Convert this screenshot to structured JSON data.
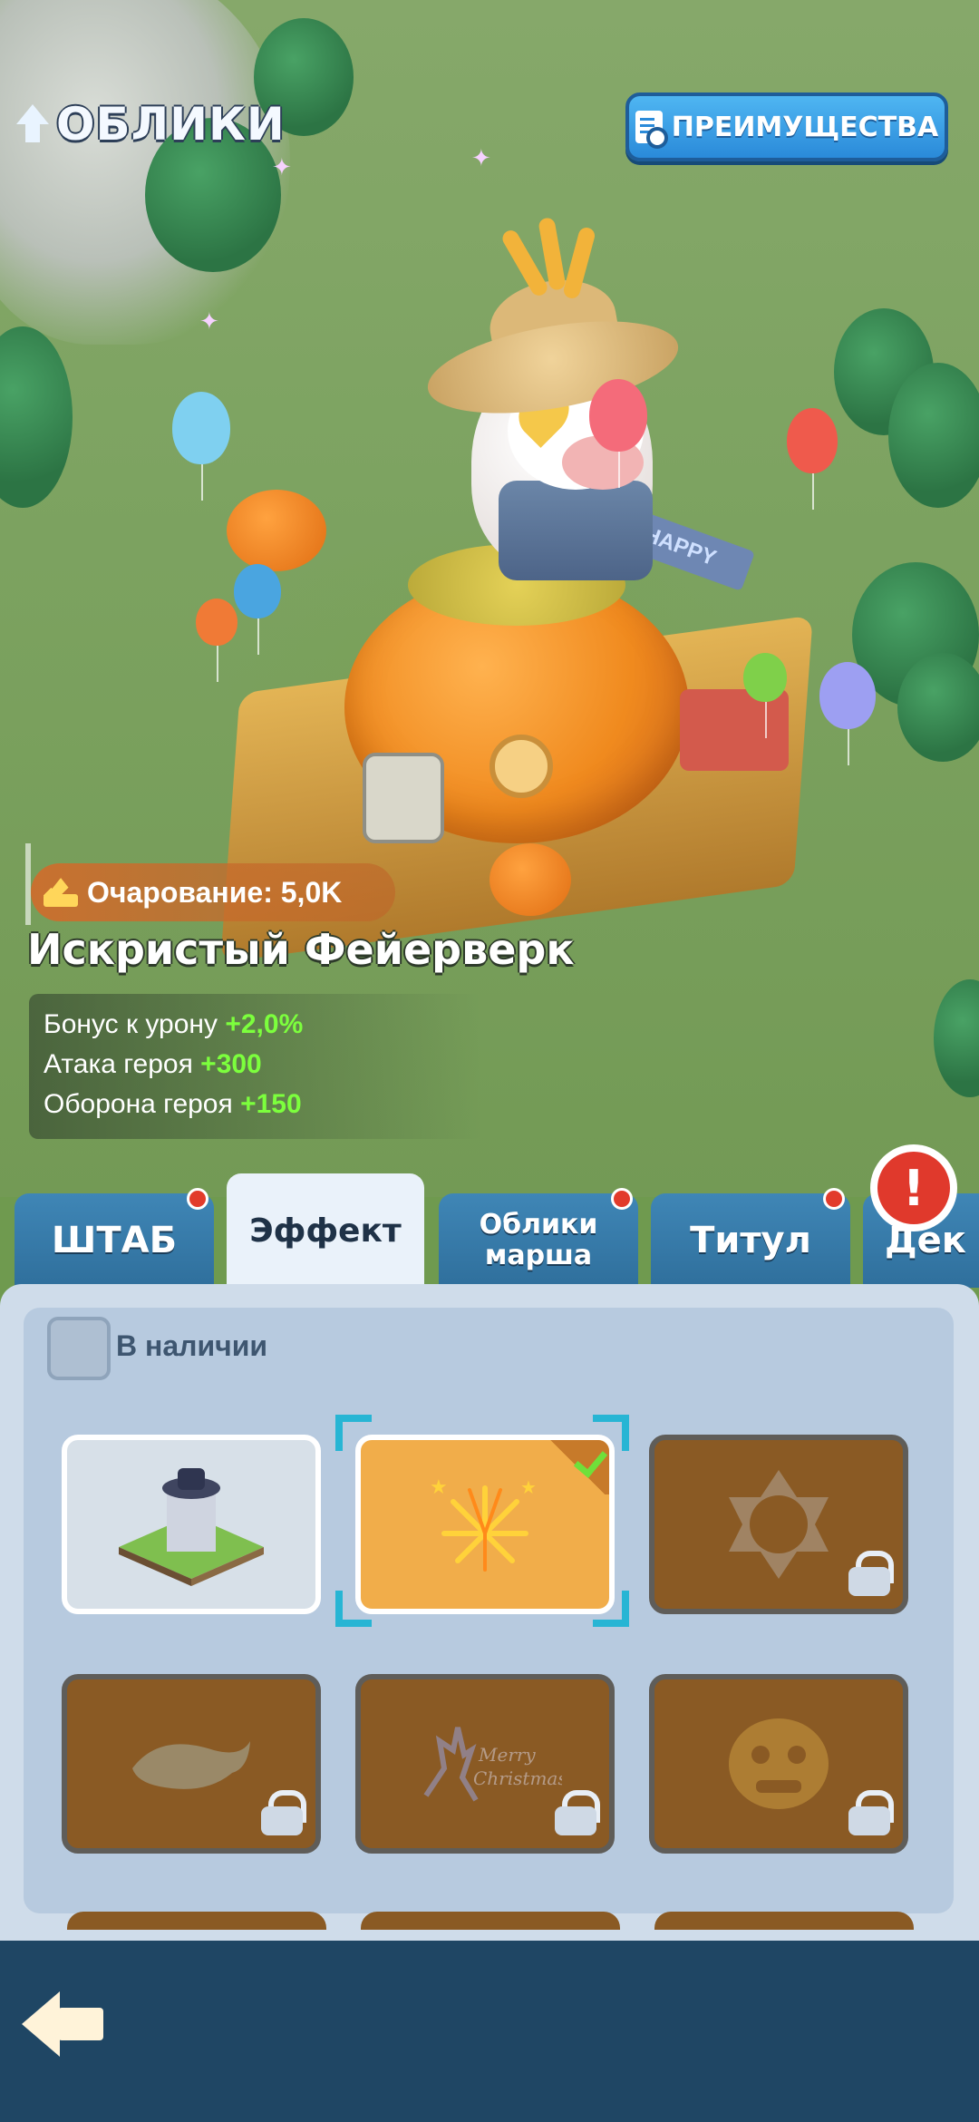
{
  "header": {
    "title": "ОБЛИКИ",
    "benefits_label": "ПРЕИМУЩЕСТВА"
  },
  "skin": {
    "charm_label": "Очарование: 5,0K",
    "name": "Искристый Фейерверк",
    "bonuses": [
      {
        "label": "Бонус к урону",
        "value": "+2,0%"
      },
      {
        "label": "Атака героя",
        "value": "+300"
      },
      {
        "label": "Оборона героя",
        "value": "+150"
      }
    ],
    "banner_text": "HAPPY"
  },
  "tabs": [
    {
      "label": "ШТАБ",
      "active": false,
      "has_notification": true
    },
    {
      "label": "Эффект",
      "active": true,
      "has_notification": false
    },
    {
      "label": "Облики марша",
      "active": false,
      "has_notification": true
    },
    {
      "label": "Титул",
      "active": false,
      "has_notification": true
    },
    {
      "label": "Дек",
      "active": false,
      "has_notification": false
    }
  ],
  "filter": {
    "available_label": "В наличии",
    "checked": false
  },
  "grid": [
    {
      "icon": "base-building-icon",
      "state": "unlocked"
    },
    {
      "icon": "fireworks-icon",
      "state": "selected-equipped"
    },
    {
      "icon": "snowflake-frame-icon",
      "state": "locked"
    },
    {
      "icon": "whale-icon",
      "state": "locked"
    },
    {
      "icon": "merry-christmas-reindeer-icon",
      "state": "locked",
      "text": "Merry Christmas"
    },
    {
      "icon": "lion-dance-icon",
      "state": "locked"
    }
  ],
  "colors": {
    "accent_blue": "#2a8ad9",
    "selected_cell": "#f1ad4a",
    "locked_cell": "#8a5a24",
    "bonus_green": "#7cff3d",
    "notification_red": "#e23b2b",
    "bottom_bar": "#1f4664"
  }
}
